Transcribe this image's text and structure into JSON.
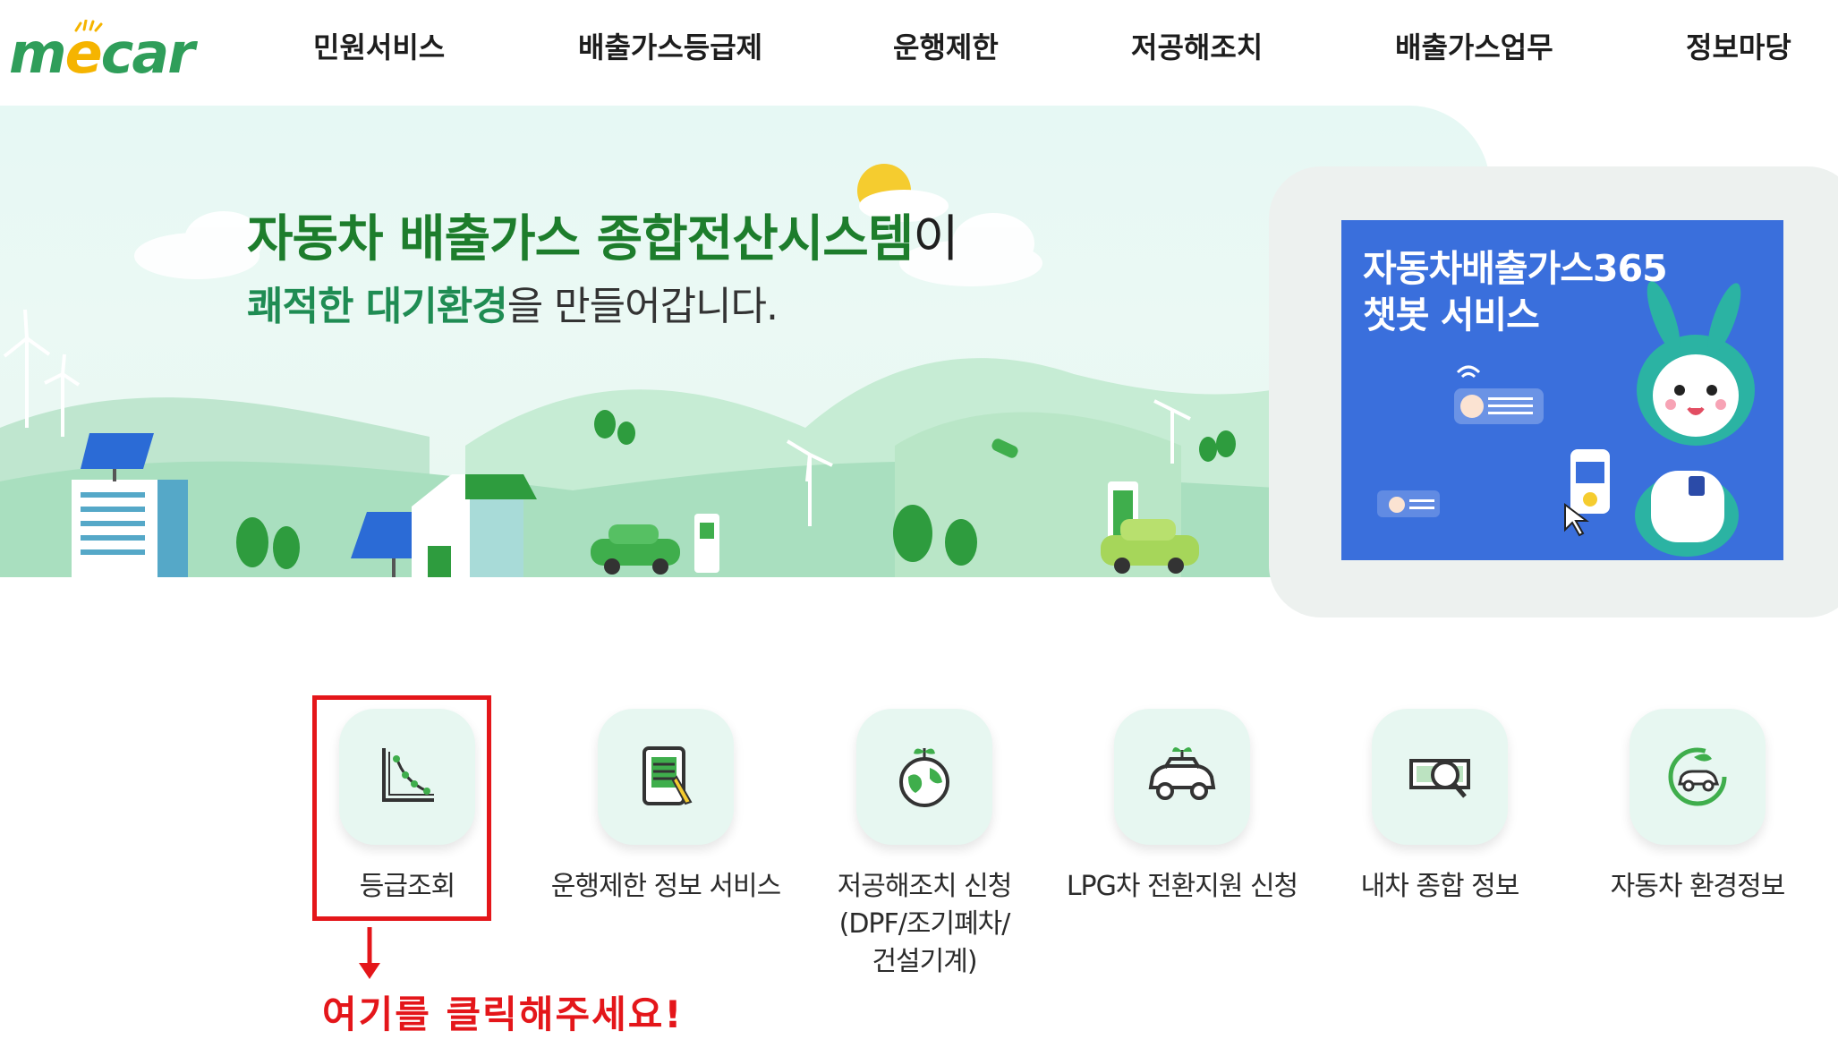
{
  "header": {
    "logo": {
      "m": "m",
      "e": "e",
      "car": "car"
    },
    "nav": [
      "민원서비스",
      "배출가스등급제",
      "운행제한",
      "저공해조치",
      "배출가스업무",
      "정보마당"
    ]
  },
  "hero": {
    "title_green": "자동차 배출가스 종합전산시스템",
    "title_tail": "이",
    "sub_green": "쾌적한 대기환경",
    "sub_tail": "을 만들어갑니다."
  },
  "chatbot_banner": {
    "line1": "자동차배출가스365",
    "line2": "챗봇 서비스"
  },
  "services": [
    {
      "label": "등급조회",
      "icon": "grade-chart-icon"
    },
    {
      "label": "운행제한 정보 서비스",
      "icon": "clipboard-icon"
    },
    {
      "label": "저공해조치 신청\n(DPF/조기폐차/\n건설기계)",
      "icon": "eco-globe-icon"
    },
    {
      "label": "LPG차 전환지원 신청",
      "icon": "eco-car-icon"
    },
    {
      "label": "내차 종합 정보",
      "icon": "money-search-icon"
    },
    {
      "label": "자동차 환경정보",
      "icon": "green-car-icon"
    }
  ],
  "annotation": {
    "text": "여기를 클릭해주세요!",
    "color": "#e4161a"
  },
  "colors": {
    "brand_green": "#1d7d2c",
    "hero_bg": "#e6f8f4",
    "banner_blue": "#3a6fdc",
    "icon_bg": "#e7f7f1"
  }
}
